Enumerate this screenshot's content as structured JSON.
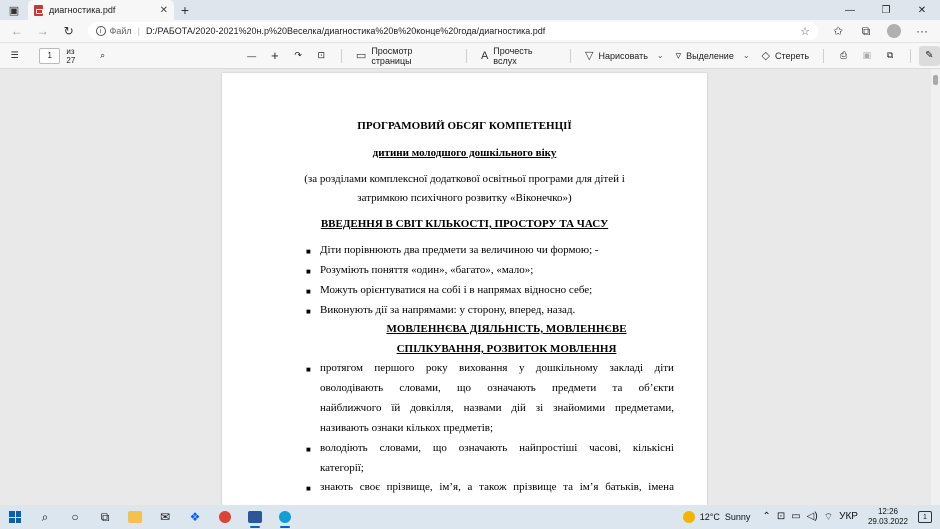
{
  "browser": {
    "tab_title": "диагностика.pdf",
    "tab_close": "✕",
    "new_tab": "+",
    "address_scheme": "Файл",
    "url": "D:/РАБОТА/2020-2021%20н.р%20Веселка/диагностика%20в%20конце%20года/диагностика.pdf"
  },
  "pdf_toolbar": {
    "page_current": "1",
    "page_total": "из 27",
    "zoom_out": "—",
    "zoom_in": "+",
    "page_view_label": "Просмотр страницы",
    "read_aloud_label": "Прочесть вслух",
    "draw_label": "Нарисовать",
    "highlight_label": "Выделение",
    "erase_label": "Стереть"
  },
  "document": {
    "title": "ПРОГРАМОВИЙ ОБСЯГ КОМПЕТЕНЦІЇ",
    "subtitle": "дитини молодшого дошкільного віку",
    "intro_line1": "(за розділами комплексної додаткової освітньої програми для дітей і",
    "intro_line2": "затримкою психічного розвитку «Віконечко»)",
    "section1_heading": "ВВЕДЕННЯ В СВІТ КІЛЬКОСТІ, ПРОСТОРУ ТА ЧАСУ",
    "section1_items": [
      "Діти порівнюють два предмети за величиною чи формою; -",
      "Розуміють поняття «один», «багато», «мало»;",
      "Можуть орієнтуватися на собі і в напрямах відносно себе;",
      "Виконують дії за напрямами: у сторону, вперед, назад."
    ],
    "section2_heading_line1": "МОВЛЕННЄВА ДІЯЛЬНІСТЬ, МОВЛЕННЄВЕ",
    "section2_heading_line2": "СПІЛКУВАННЯ, РОЗВИТОК МОВЛЕННЯ",
    "section2_item1": {
      "line1": [
        "протягом",
        "першого",
        "року",
        "виховання",
        "у",
        "дошкільному",
        "закладі",
        "діти"
      ],
      "line2": [
        "оволодівають",
        "словами,",
        "що",
        "означають",
        "предмети",
        "та",
        "об’єкти"
      ],
      "line3": [
        "найближчого",
        "їй",
        "довкілля,",
        "назвами",
        "дій",
        "зі",
        "знайомими",
        "предметами,"
      ],
      "line4": "називають ознаки кількох предметів;"
    },
    "section2_item2": {
      "line1": [
        "володіють",
        "словами,",
        "що",
        "означають",
        "найпростіші",
        "часові,",
        "кількісні"
      ],
      "line2": "категорії;"
    },
    "section2_item3": {
      "line1": [
        "знають",
        "своє",
        "прізвище,",
        "ім’я,",
        "а",
        "також",
        "прізвище",
        "та",
        "ім’я",
        "батьків,",
        "імена"
      ]
    }
  },
  "taskbar": {
    "temperature": "12°C",
    "weather": "Sunny",
    "language": "УКР",
    "time": "12:26",
    "date": "29.03.2022",
    "notifications": "1"
  }
}
